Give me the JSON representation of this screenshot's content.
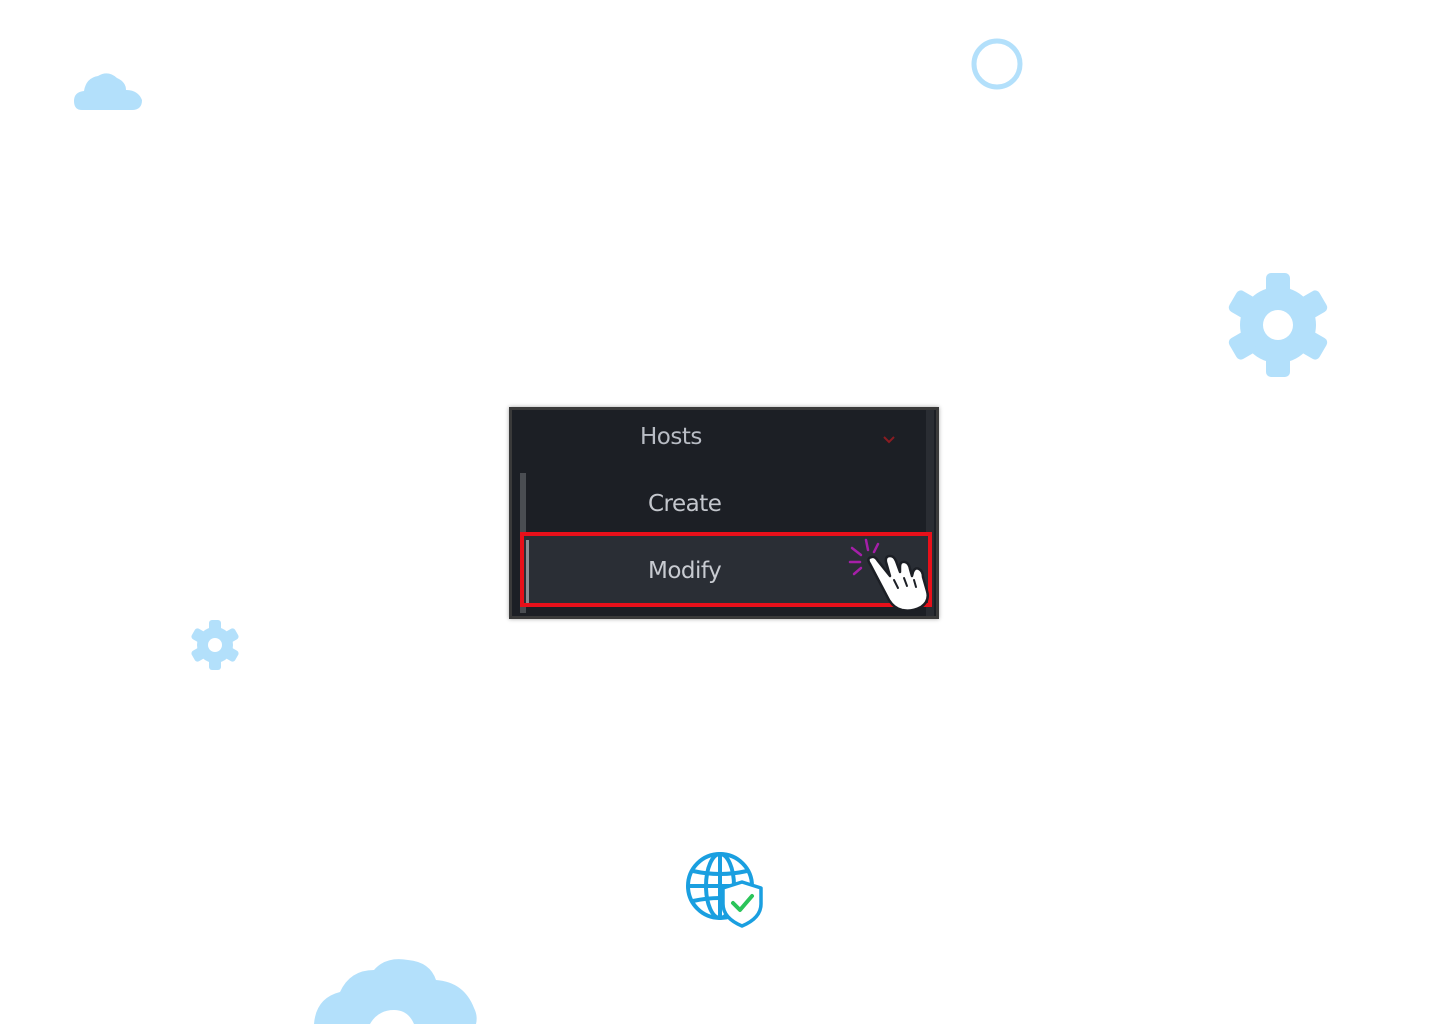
{
  "menu": {
    "parent_label": "Hosts",
    "items": [
      {
        "label": "Create",
        "selected": false
      },
      {
        "label": "Modify",
        "selected": true
      }
    ]
  },
  "icons": {
    "chevron": "chevron-down-icon",
    "cursor": "hand-pointer-click-icon",
    "globe": "globe-shield-check-icon",
    "decorations": [
      "cloud-icon",
      "circle-icon",
      "gear-icon",
      "gear-icon",
      "cloud-icon"
    ]
  },
  "colors": {
    "panel_background": "#1c1f25",
    "selected_item_background": "#2a2e35",
    "highlight_border": "#e8101a",
    "decoration_blue": "#b3e0fb",
    "chevron": "#8a1c22",
    "globe_blue": "#1a9fe0",
    "check_green": "#2bc45a"
  }
}
